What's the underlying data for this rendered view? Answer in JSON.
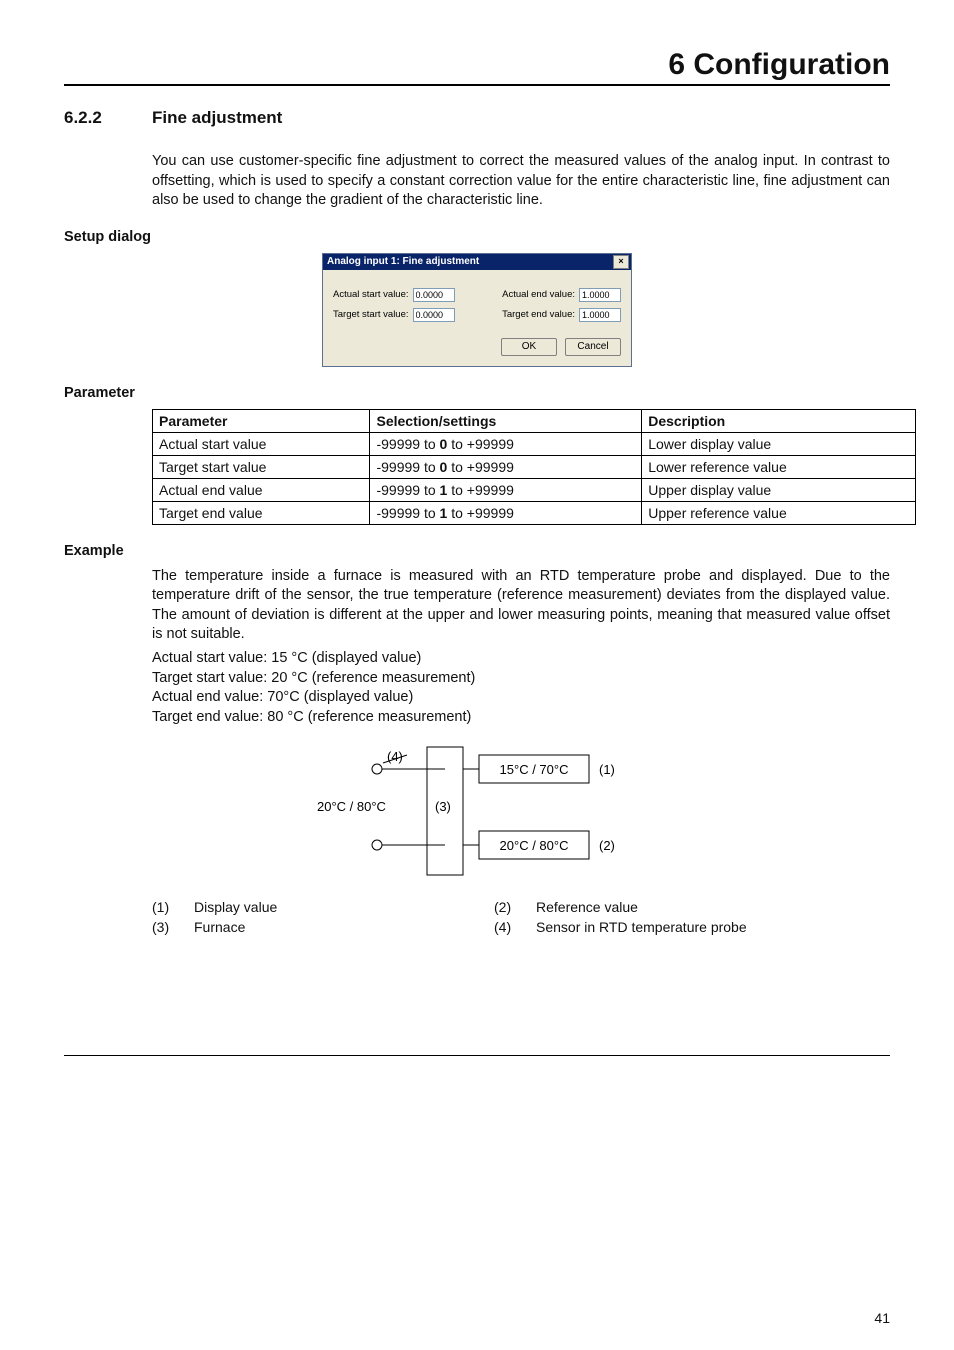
{
  "chapterTitle": "6 Configuration",
  "section": {
    "num": "6.2.2",
    "title": "Fine adjustment"
  },
  "intro": "You can use customer-specific fine adjustment to correct the measured values of the analog input. In contrast to offsetting, which is used to specify a constant correction value for the entire characteristic line, fine adjustment can also be used to change the gradient of the characteristic line.",
  "subheads": {
    "setupDialog": "Setup dialog",
    "parameter": "Parameter",
    "example": "Example"
  },
  "dialog": {
    "title": "Analog input 1: Fine adjustment",
    "close": "×",
    "fields": {
      "actualStart": {
        "label": "Actual start value:",
        "value": "0.0000"
      },
      "targetStart": {
        "label": "Target start value:",
        "value": "0.0000"
      },
      "actualEnd": {
        "label": "Actual end value:",
        "value": "1.0000"
      },
      "targetEnd": {
        "label": "Target end value:",
        "value": "1.0000"
      }
    },
    "ok": "OK",
    "cancel": "Cancel"
  },
  "table": {
    "headers": {
      "param": "Parameter",
      "sel": "Selection/settings",
      "desc": "Description"
    },
    "rows": [
      {
        "param": "Actual start value",
        "selPre": "-99999 to ",
        "selBold": "0",
        "selPost": " to +99999",
        "desc": "Lower display value"
      },
      {
        "param": "Target start value",
        "selPre": "-99999 to ",
        "selBold": "0",
        "selPost": " to +99999",
        "desc": "Lower reference value"
      },
      {
        "param": "Actual end value",
        "selPre": "-99999 to ",
        "selBold": "1",
        "selPost": " to +99999",
        "desc": "Upper display value"
      },
      {
        "param": "Target end value",
        "selPre": "-99999 to ",
        "selBold": "1",
        "selPost": " to +99999",
        "desc": "Upper reference value"
      }
    ]
  },
  "example": {
    "para": "The temperature inside a furnace is measured with an RTD temperature probe and displayed. Due to the temperature drift of the sensor, the true temperature (reference measurement) deviates from the displayed value. The amount of deviation is different at the upper and lower measuring points, meaning that measured value offset is not suitable.",
    "lines": [
      "Actual start value: 15 °C (displayed value)",
      "Target start value: 20 °C (reference measurement)",
      "Actual end value: 70°C (displayed value)",
      "Target end value: 80 °C (reference measurement)"
    ]
  },
  "diagram": {
    "box1": "15°C / 70°C",
    "box2": "20°C / 80°C",
    "leftLabel": "20°C / 80°C",
    "n1": "(1)",
    "n2": "(2)",
    "n3": "(3)",
    "n4": "(4)"
  },
  "legend": {
    "r1": {
      "n1": "(1)",
      "t1": "Display value",
      "n2": "(2)",
      "t2": "Reference value"
    },
    "r2": {
      "n1": "(3)",
      "t1": "Furnace",
      "n2": "(4)",
      "t2": "Sensor in RTD temperature probe"
    }
  },
  "pageNum": "41"
}
